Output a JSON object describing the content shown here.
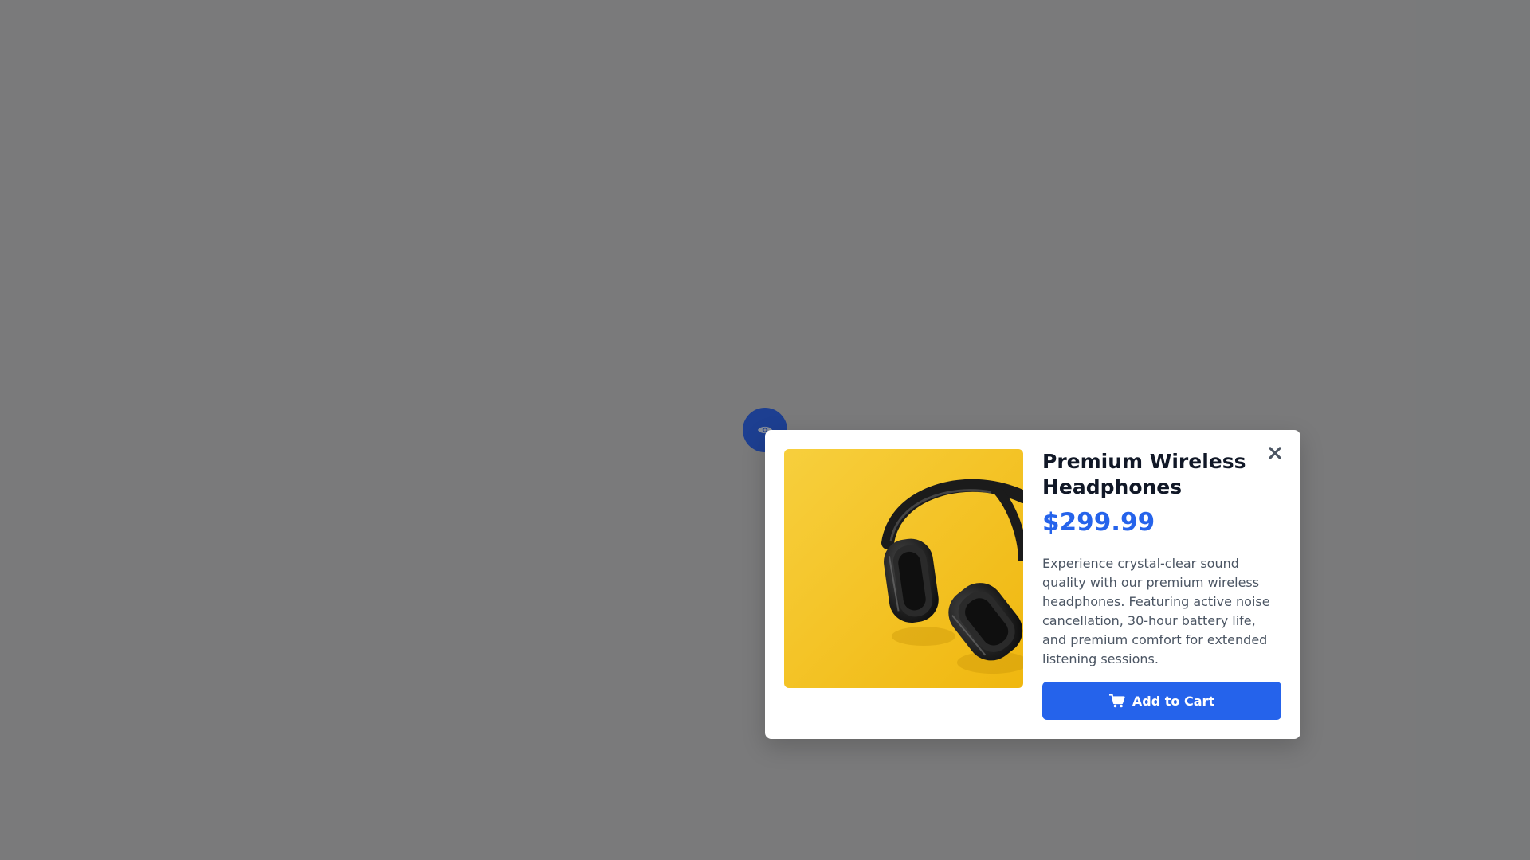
{
  "quick_view": {
    "trigger_icon": "eye-icon",
    "trigger_color": "#1d3f91"
  },
  "modal": {
    "close_icon": "close-icon",
    "product_image_icon": "headphones-image",
    "product": {
      "title": "Premium Wireless Headphones",
      "price": "$299.99",
      "description": "Experience crystal-clear sound quality with our premium wireless headphones. Featuring active noise cancellation, 30-hour battery life, and premium comfort for extended listening sessions."
    },
    "add_to_cart": {
      "label": "Add to Cart",
      "icon": "cart-icon"
    }
  },
  "colors": {
    "overlay": "#7a7a7b",
    "accent": "#2563eb",
    "title": "#111827",
    "body_text": "#4b5563",
    "image_background": "#f5c430"
  }
}
